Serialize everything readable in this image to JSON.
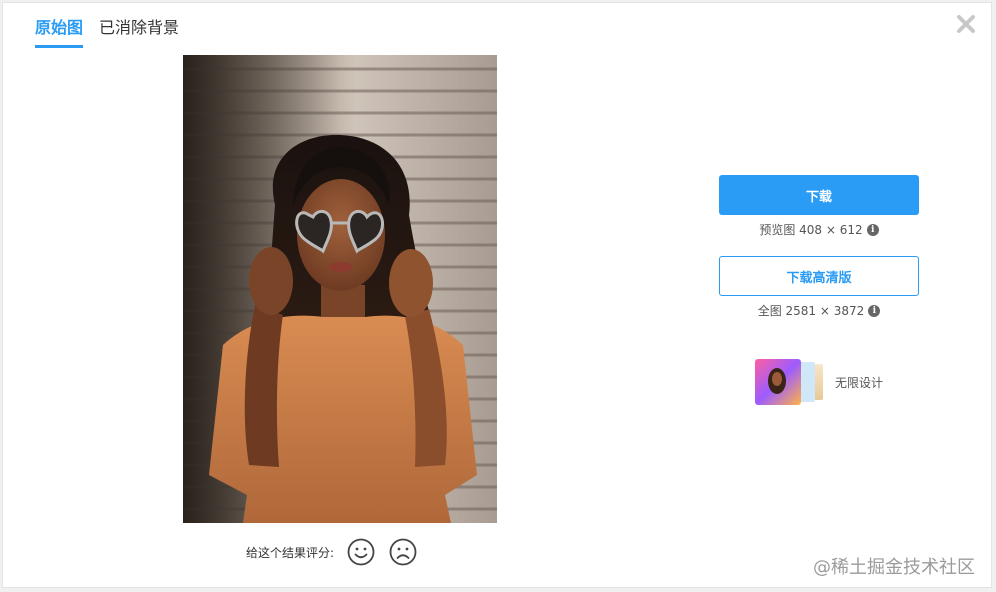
{
  "tabs": [
    {
      "label": "原始图",
      "active": true
    },
    {
      "label": "已消除背景",
      "active": false
    }
  ],
  "close_icon": "close-icon",
  "rating": {
    "label": "给这个结果评分:",
    "happy_icon": "smile-icon",
    "sad_icon": "frown-icon"
  },
  "download": {
    "button_label": "下载",
    "preview_info": "预览图 408 × 612",
    "hd_button_label": "下载高清版",
    "full_info": "全图 2581 × 3872"
  },
  "promo": {
    "label": "无限设计"
  },
  "watermark": "@稀土掘金技术社区",
  "colors": {
    "accent": "#2a9cf5",
    "text": "#333333"
  }
}
